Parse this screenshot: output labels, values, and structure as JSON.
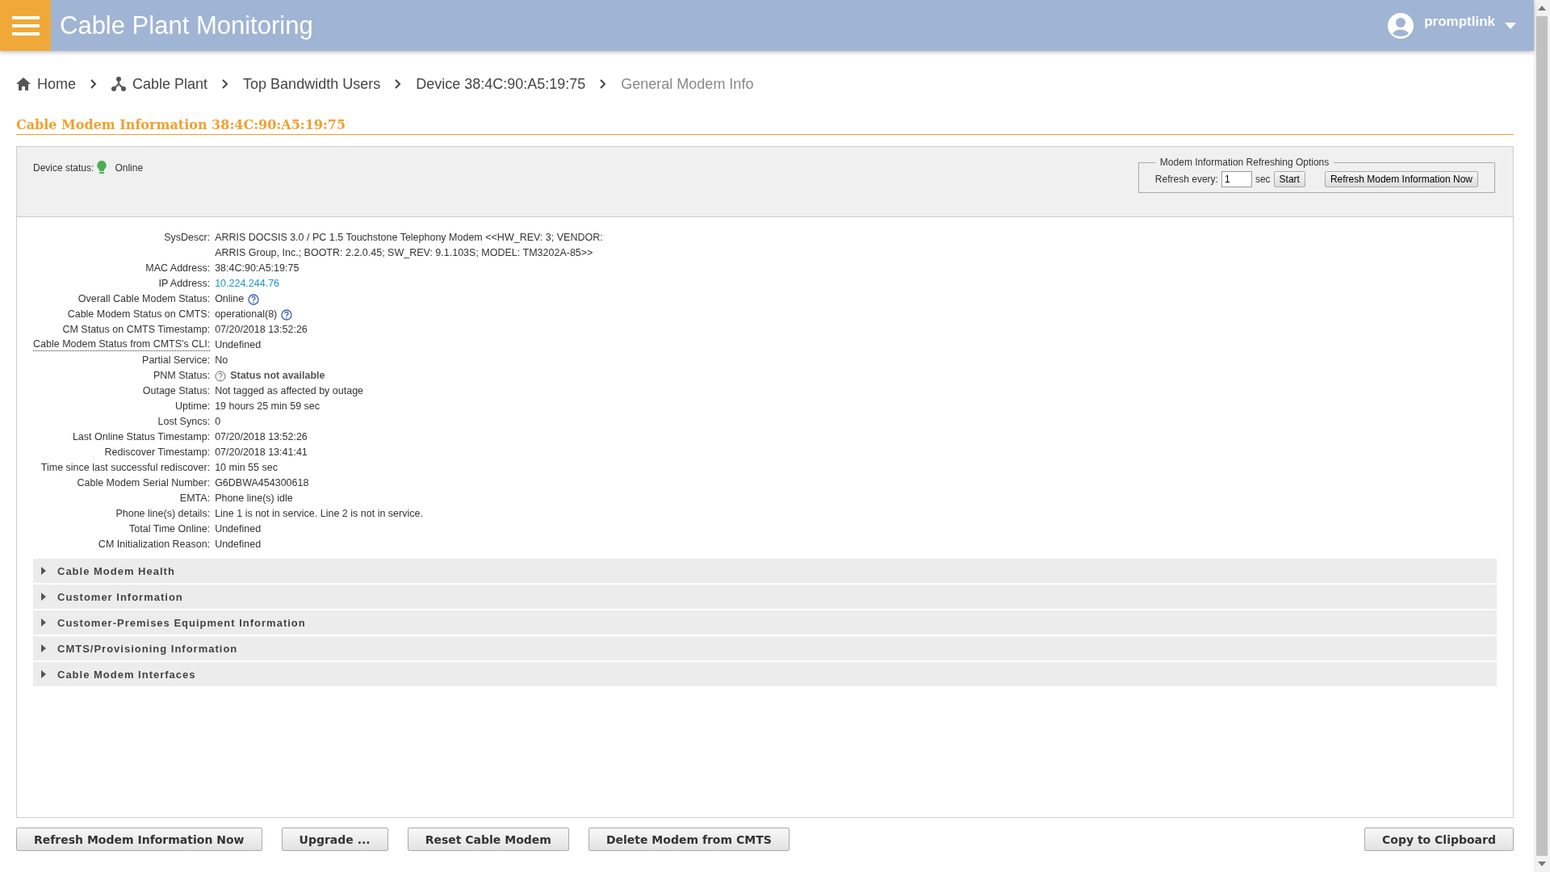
{
  "header": {
    "title": "Cable Plant Monitoring",
    "user": "promptlink"
  },
  "breadcrumb": [
    {
      "label": "Home",
      "kind": "home",
      "current": false
    },
    {
      "label": "Cable Plant",
      "kind": "plant",
      "current": false
    },
    {
      "label": "Top Bandwidth Users",
      "kind": "plain",
      "current": false
    },
    {
      "label": "Device 38:4C:90:A5:19:75",
      "kind": "plain",
      "current": false
    },
    {
      "label": "General Modem Info",
      "kind": "plain",
      "current": true
    }
  ],
  "page_title": "Cable Modem Information 38:4C:90:A5:19:75",
  "device_status": {
    "label": "Device status:",
    "value": "Online",
    "color": "#4caf50"
  },
  "refresh_options": {
    "legend": "Modem Information Refreshing Options",
    "label": "Refresh every:",
    "value": "1",
    "unit": "sec",
    "start_button": "Start",
    "refresh_button": "Refresh Modem Information Now"
  },
  "info_rows": [
    {
      "label": "SysDescr:",
      "value": "ARRIS DOCSIS 3.0 / PC 1.5 Touchstone Telephony Modem <<HW_REV: 3; VENDOR: ARRIS Group, Inc.; BOOTR: 2.2.0.45; SW_REV: 9.1.103S; MODEL: TM3202A-85>>",
      "kind": "text",
      "hint_label": false
    },
    {
      "label": "MAC Address:",
      "value": "38:4C:90:A5:19:75",
      "kind": "text",
      "hint_label": false
    },
    {
      "label": "IP Address:",
      "value": "10.224.244.76",
      "kind": "link",
      "hint_label": false
    },
    {
      "label": "Overall Cable Modem Status:",
      "value": "Online",
      "kind": "help",
      "hint_label": false
    },
    {
      "label": "Cable Modem Status on CMTS:",
      "value": "operational(8)",
      "kind": "help",
      "hint_label": false
    },
    {
      "label": "CM Status on CMTS Timestamp:",
      "value": "07/20/2018 13:52:26",
      "kind": "text",
      "hint_label": false
    },
    {
      "label": "Cable Modem Status from CMTS's CLI:",
      "value": "Undefined",
      "kind": "text",
      "hint_label": true
    },
    {
      "label": "Partial Service:",
      "value": "No",
      "kind": "text",
      "hint_label": false
    },
    {
      "label": "PNM Status:",
      "value": "Status not available",
      "kind": "unknown",
      "hint_label": false
    },
    {
      "label": "Outage Status:",
      "value": "Not tagged as affected by outage",
      "kind": "text",
      "hint_label": false
    },
    {
      "label": "Uptime:",
      "value": "19 hours 25 min 59 sec",
      "kind": "text",
      "hint_label": false
    },
    {
      "label": "Lost Syncs:",
      "value": "0",
      "kind": "text",
      "hint_label": false
    },
    {
      "label": "Last Online Status Timestamp:",
      "value": "07/20/2018 13:52:26",
      "kind": "text",
      "hint_label": false
    },
    {
      "label": "Rediscover Timestamp:",
      "value": "07/20/2018 13:41:41",
      "kind": "text",
      "hint_label": false
    },
    {
      "label": "Time since last successful rediscover:",
      "value": "10 min 55 sec",
      "kind": "text",
      "hint_label": false
    },
    {
      "label": "Cable Modem Serial Number:",
      "value": "G6DBWA454300618",
      "kind": "text",
      "hint_label": false
    },
    {
      "label": "EMTA:",
      "value": "Phone line(s) idle",
      "kind": "text",
      "hint_label": false
    },
    {
      "label": "Phone line(s) details:",
      "value": "Line 1 is not in service. Line 2 is not in service.",
      "kind": "text",
      "hint_label": false
    },
    {
      "label": "Total Time Online:",
      "value": "Undefined",
      "kind": "text",
      "hint_label": false
    },
    {
      "label": "CM Initialization Reason:",
      "value": "Undefined",
      "kind": "text",
      "hint_label": false
    }
  ],
  "sections": [
    {
      "label": "Cable Modem Health",
      "expanded": false
    },
    {
      "label": "Customer Information",
      "expanded": false
    },
    {
      "label": "Customer-Premises Equipment Information",
      "expanded": false
    },
    {
      "label": "CMTS/Provisioning Information",
      "expanded": false
    },
    {
      "label": "Cable Modem Interfaces",
      "expanded": false
    }
  ],
  "actions": [
    "Refresh Modem Information Now",
    "Upgrade ...",
    "Reset Cable Modem",
    "Delete Modem from CMTS"
  ],
  "copy_button": "Copy to Clipboard"
}
